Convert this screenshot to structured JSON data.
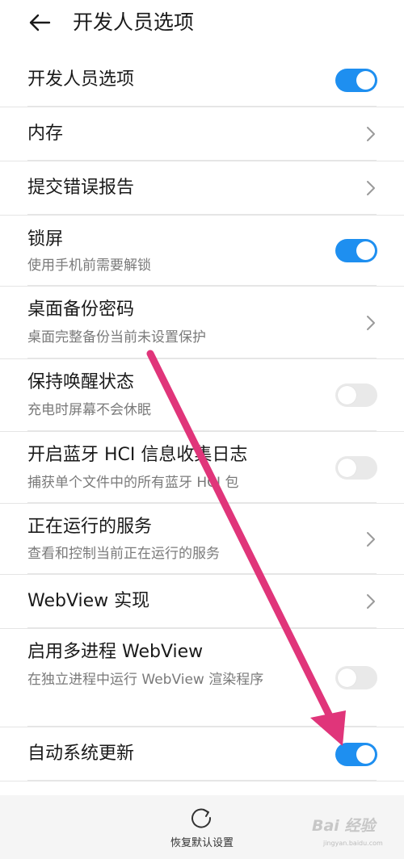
{
  "header": {
    "title": "开发人员选项"
  },
  "rows": [
    {
      "title": "开发人员选项",
      "control": "toggle",
      "state": "on"
    },
    {
      "title": "内存",
      "control": "chevron"
    },
    {
      "title": "提交错误报告",
      "control": "chevron"
    },
    {
      "title": "锁屏",
      "subtitle": "使用手机前需要解锁",
      "control": "toggle",
      "state": "on"
    },
    {
      "title": "桌面备份密码",
      "subtitle": "桌面完整备份当前未设置保护",
      "control": "chevron"
    },
    {
      "title": "保持唤醒状态",
      "subtitle": "充电时屏幕不会休眠",
      "control": "toggle",
      "state": "off"
    },
    {
      "title": "开启蓝牙 HCI 信息收集日志",
      "subtitle": "捕获单个文件中的所有蓝牙 HCI 包",
      "control": "toggle",
      "state": "off"
    },
    {
      "title": "正在运行的服务",
      "subtitle": "查看和控制当前正在运行的服务",
      "control": "chevron"
    },
    {
      "title": "WebView 实现",
      "control": "chevron"
    },
    {
      "title": "启用多进程 WebView",
      "subtitle": "在独立进程中运行 WebView 渲染程序",
      "control": "toggle",
      "state": "off"
    },
    {
      "title": "自动系统更新",
      "control": "toggle",
      "state": "on"
    }
  ],
  "bottom": {
    "reset_label": "恢复默认设置"
  },
  "watermark": {
    "text": "Bai 经验",
    "sub": "jingyan.baidu.com"
  },
  "colors": {
    "toggle_on": "#1e8ff0",
    "toggle_off": "#e9e9e9",
    "annotation_arrow": "#e0357a"
  },
  "icons": {
    "back": "arrow-left-icon",
    "chevron": "chevron-right-icon",
    "reset": "refresh-icon"
  }
}
